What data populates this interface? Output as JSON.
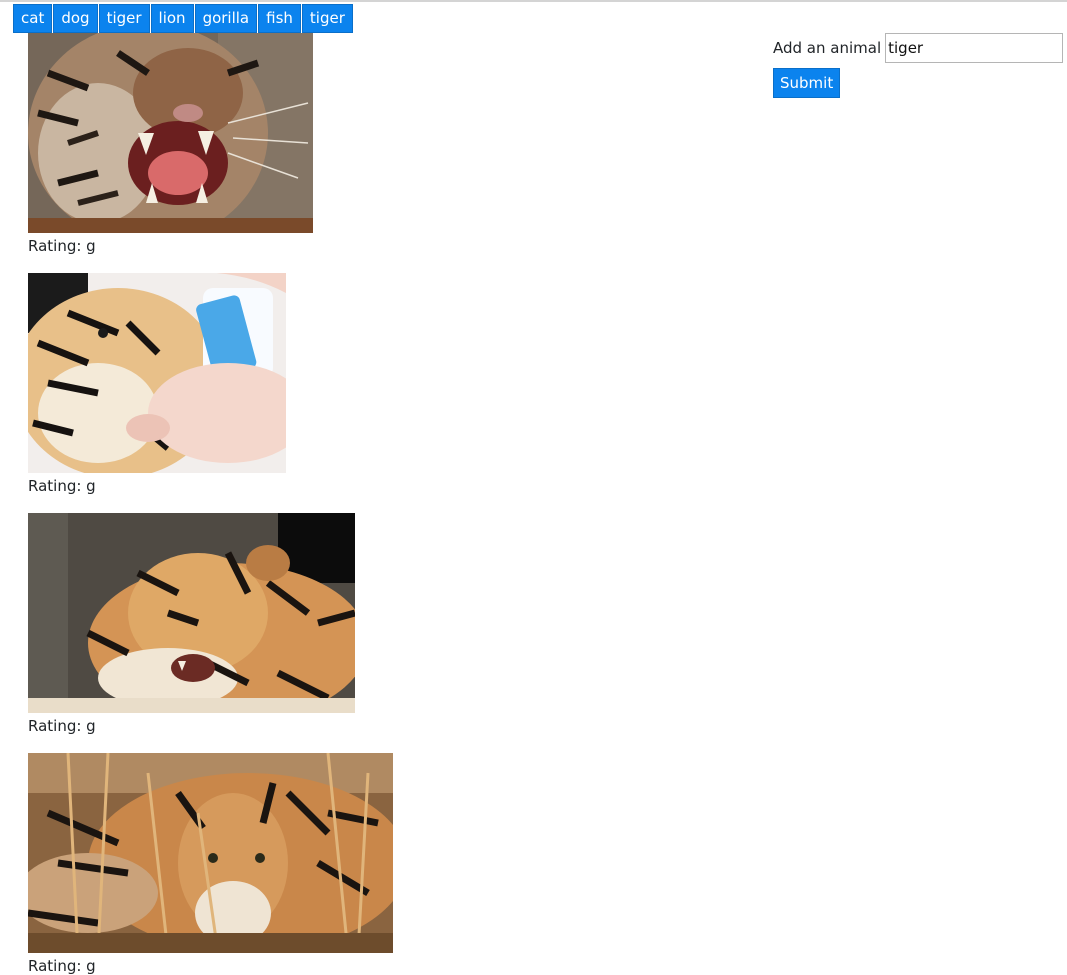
{
  "buttons": [
    {
      "label": "cat"
    },
    {
      "label": "dog"
    },
    {
      "label": "tiger"
    },
    {
      "label": "lion"
    },
    {
      "label": "gorilla"
    },
    {
      "label": "fish"
    },
    {
      "label": "tiger"
    }
  ],
  "gifs": [
    {
      "rating": "Rating: g"
    },
    {
      "rating": "Rating: g"
    },
    {
      "rating": "Rating: g"
    },
    {
      "rating": "Rating: g"
    }
  ],
  "form": {
    "label": "Add an animal",
    "input_value": "tiger",
    "submit_label": "Submit"
  },
  "colors": {
    "button_bg": "#0b83ee",
    "button_text": "#ffffff"
  }
}
